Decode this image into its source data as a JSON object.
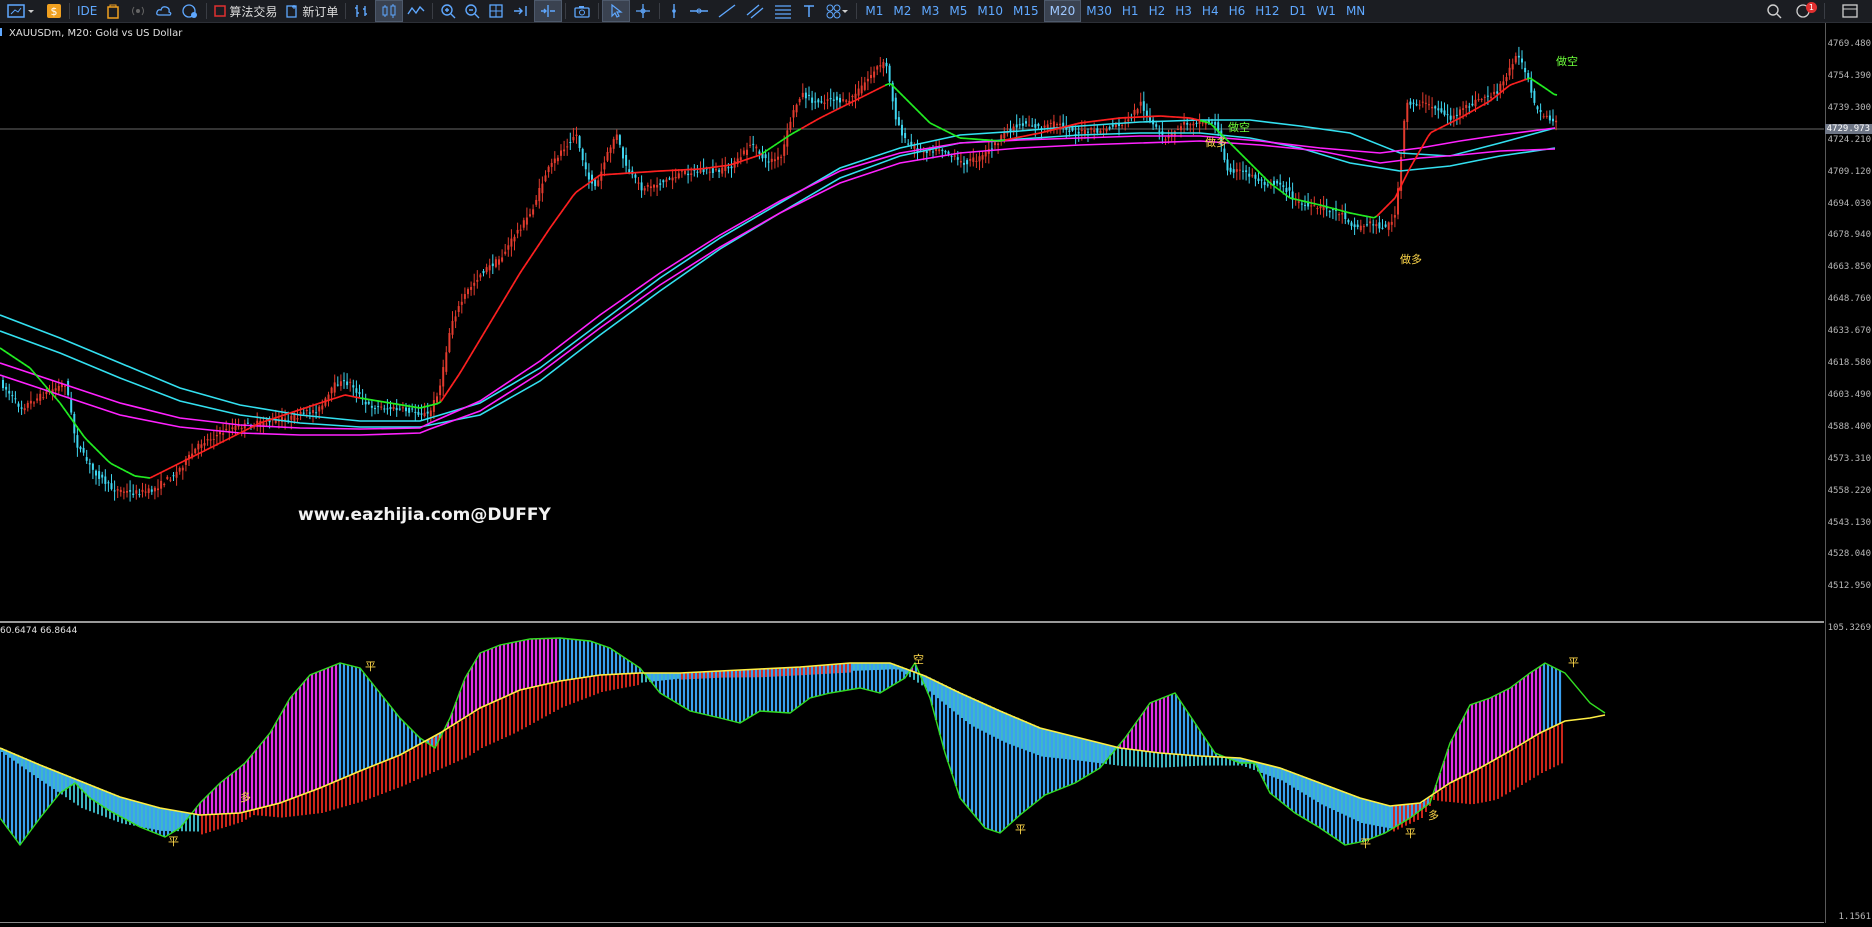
{
  "toolbar": {
    "ide_label": "IDE",
    "algo_trading_label": "算法交易",
    "new_order_label": "新订单",
    "timeframes": [
      "M1",
      "M2",
      "M3",
      "M5",
      "M10",
      "M15",
      "M20",
      "M30",
      "H1",
      "H2",
      "H3",
      "H4",
      "H6",
      "H12",
      "D1",
      "W1",
      "MN"
    ],
    "active_timeframe": "M20",
    "notification_count": "1"
  },
  "chart": {
    "symbol_title": "XAUUSDm, M20:  Gold vs US Dollar",
    "indicator_values": "60.6474 66.8644",
    "current_price": "4729.973",
    "watermark": "www.eazhijia.com@DUFFY",
    "price_ticks": [
      "4769.480",
      "4754.390",
      "4739.300",
      "4724.210",
      "4709.120",
      "4694.030",
      "4678.940",
      "4663.850",
      "4648.760",
      "4633.670",
      "4618.580",
      "4603.490",
      "4588.400",
      "4573.310",
      "4558.220",
      "4543.130",
      "4528.040",
      "4512.950"
    ],
    "indicator_ticks": [
      "105.3269",
      "1.1561"
    ],
    "signals_main": [
      {
        "text": "做空",
        "color": "green"
      },
      {
        "text": "做多",
        "color": "yellow"
      },
      {
        "text": "做多",
        "color": "yellow"
      },
      {
        "text": "做空",
        "color": "yellow"
      }
    ],
    "signals_ind": [
      "平",
      "多",
      "平",
      "空",
      "平",
      "平",
      "平",
      "多",
      "平"
    ]
  },
  "colors": {
    "bull": "#e23b2e",
    "bear": "#3fd6f0",
    "ma_fast_up": "#ff2020",
    "ma_fast_down": "#22ee22",
    "ma_mid": "#33e0f0",
    "ma_slow": "#ff22ff",
    "signal": "#ffd84a"
  }
}
